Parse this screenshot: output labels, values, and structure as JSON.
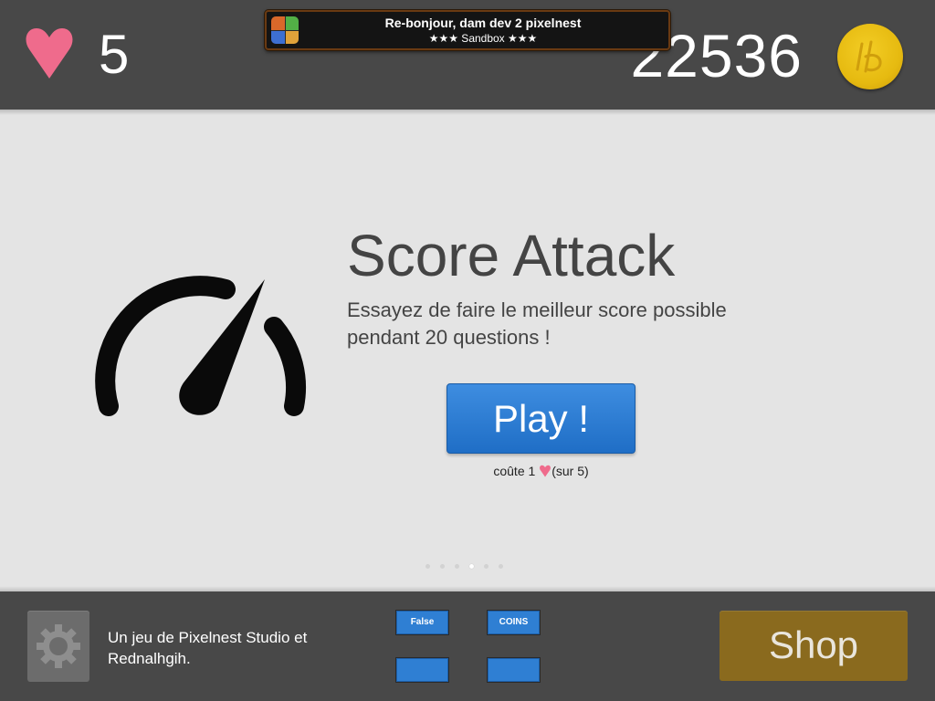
{
  "top_bar": {
    "lives": "5",
    "score": "22536",
    "coin_icon": "coin-icon"
  },
  "notification": {
    "title": "Re-bonjour, dam dev 2 pixelnest",
    "subtitle": "★★★ Sandbox ★★★"
  },
  "mode": {
    "title": "Score Attack",
    "description": "Essayez de faire le meilleur score possible pendant 20 questions !",
    "icon": "speedometer-icon",
    "play_label": "Play !",
    "cost_before": "coûte 1",
    "cost_after": "(sur 5)"
  },
  "pager": {
    "count": 6,
    "active_index": 3
  },
  "bottom_bar": {
    "credits": "Un jeu de Pixelnest Studio et Rednalhgih.",
    "debug_buttons": [
      "False",
      "COINS",
      "",
      ""
    ],
    "shop_label": "Shop"
  },
  "colors": {
    "bar_bg": "#484848",
    "content_bg": "#e4e4e4",
    "heart": "#ef6b8c",
    "play_blue": "#2a7dd6",
    "shop_gold": "#8a6a1e",
    "coin_gold": "#e6ba10"
  }
}
